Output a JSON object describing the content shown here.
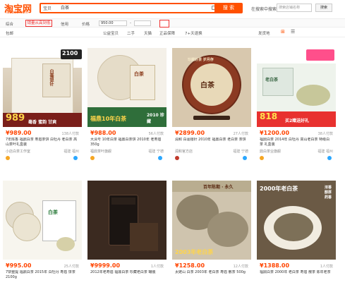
{
  "header": {
    "logo": "淘宝网",
    "logo_sub": "Taobao.com",
    "search_scope": "宝贝",
    "search_value": "白茶",
    "search_button": "搜 索",
    "shop_search_label": "在搜索中搜索",
    "store_placeholder": "搜索店铺名称",
    "store_button": "搜索"
  },
  "filters": {
    "all": "综合",
    "sort": "销量从高到低",
    "credit": "信用",
    "price": "价格",
    "price_from": "950.00",
    "discount": "包邮",
    "cn_sell": "公益宝贝",
    "second_hand": "二手",
    "tmall": "天猫",
    "genuine": "正品保障",
    "return7": "7+天退换",
    "location": "发货地",
    "view_grid": "⊞",
    "view_list": "☰"
  },
  "products": [
    {
      "price": "¥989.00",
      "sold": "138人付款",
      "title": "7年陈香 福鼎白茶 寿眉茶饼 白牡丹 老白茶 高山茶叶礼盒装",
      "shop": "小店白茶工作室",
      "loc": "福建 福州",
      "tag": "989",
      "thumb_text": "白毫银针",
      "thumb_sub": "毫香 蜜韵 甘爽",
      "corner": "2100"
    },
    {
      "price": "¥988.00",
      "sold": "56人付款",
      "title": "大清号 10年白茶 福鼎白茶饼 2010年 老寿眉 350g",
      "shop": "福鼎茶叶旗舰",
      "loc": "福建 宁德",
      "tag": "福鼎10年白茶",
      "thumb_text": "白茶",
      "thumb_sub": "2010 珍藏",
      "corner": ""
    },
    {
      "price": "¥2899.00",
      "sold": "27人付款",
      "title": "润和 白毫银针 2010年 福鼎白茶 老白茶 茶饼",
      "shop": "润和官方店",
      "loc": "福建 宁德",
      "tag": "",
      "thumb_text": "白茶",
      "thumb_sub": "珍藏好茶 岁月存",
      "corner": ""
    },
    {
      "price": "¥1200.00",
      "sold": "38人付款",
      "title": "福鼎白茶 2014年 白牡丹 高山老白茶 特级白茶 礼盒装",
      "shop": "鼎白茶业旗舰",
      "loc": "福建 福州",
      "tag": "818",
      "thumb_text": "老白茶",
      "thumb_sub": "买2赠送好礼",
      "corner": ""
    },
    {
      "price": "¥995.00",
      "sold": "25人付款",
      "title": "7饼整提 福鼎白茶 2015年 白牡丹 寿眉 饼茶 2100g",
      "shop": "卢洛白茶旗舰",
      "loc": "福建 福州",
      "tag": "",
      "thumb_text": "白茶",
      "thumb_sub": "",
      "corner": ""
    },
    {
      "price": "¥9999.00",
      "sold": "1人付款",
      "title": "2012年老寿眉 福鼎白茶 珍藏老白茶 罐装",
      "shop": "白茶专卖",
      "loc": "福建 宁德",
      "tag": "",
      "thumb_text": "",
      "thumb_sub": "",
      "corner": ""
    },
    {
      "price": "¥1258.00",
      "sold": "12人付款",
      "title": "太姥山 白茶 2003年 老白茶 寿眉 散茶 500g",
      "shop": "茶叶店",
      "loc": "福建 福州",
      "tag": "2003年老白茶",
      "thumb_text": "百年陈期 · 永久",
      "thumb_sub": "",
      "corner": ""
    },
    {
      "price": "¥1388.00",
      "sold": "1人付款",
      "title": "福鼎白茶 2000年 老白茶 寿眉 散茶 陈年老茶",
      "shop": "福鼎老白茶",
      "loc": "福建 宁德",
      "tag": "",
      "thumb_text": "2000年老白茶",
      "thumb_sub": "浓香 醇厚 药香",
      "corner": ""
    }
  ]
}
